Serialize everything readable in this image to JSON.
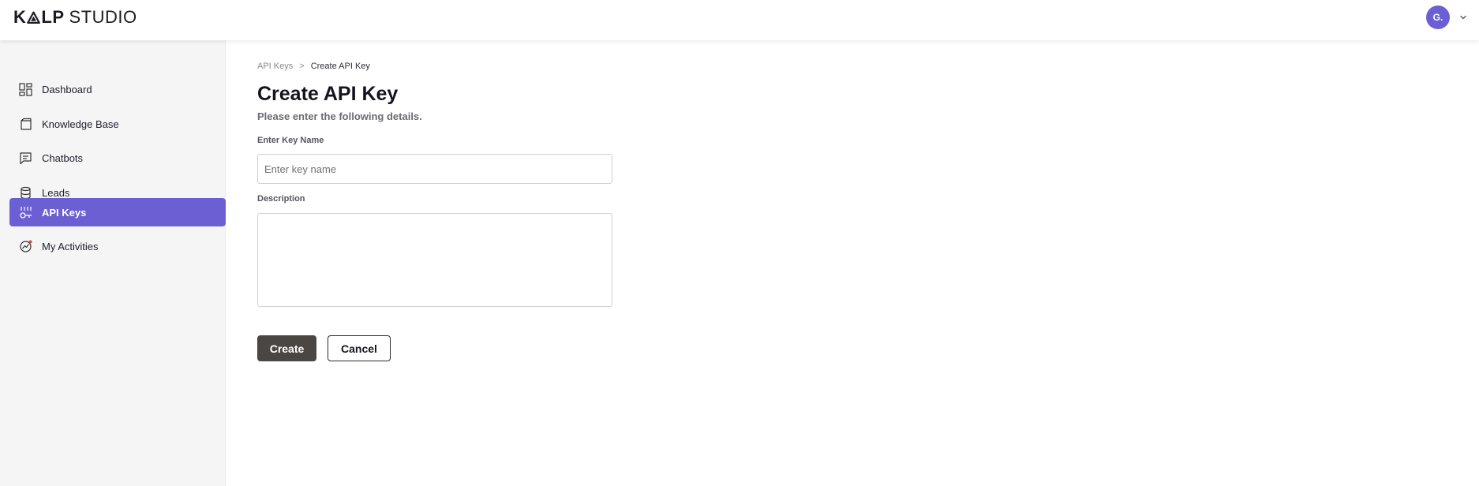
{
  "header": {
    "logo_bold": "K",
    "logo_bold2": "LP",
    "logo_light": "STUDIO",
    "avatar_initials": "G."
  },
  "sidebar": {
    "items": [
      {
        "label": "Dashboard",
        "icon": "dashboard-icon",
        "active": false
      },
      {
        "label": "Knowledge Base",
        "icon": "knowledge-base-icon",
        "active": false
      },
      {
        "label": "Chatbots",
        "icon": "chatbots-icon",
        "active": false
      },
      {
        "label": "Leads",
        "icon": "leads-icon",
        "active": false
      },
      {
        "label": "API Keys",
        "icon": "api-keys-icon",
        "active": true
      },
      {
        "label": "My Activities",
        "icon": "my-activities-icon",
        "active": false
      }
    ]
  },
  "breadcrumb": {
    "parent": "API Keys",
    "separator": ">",
    "current": "Create API Key"
  },
  "form": {
    "title": "Create API Key",
    "subtitle": "Please enter the following details.",
    "key_name_label": "Enter Key Name",
    "key_name_placeholder": "Enter key name",
    "key_name_value": "",
    "description_label": "Description",
    "description_value": "",
    "create_label": "Create",
    "cancel_label": "Cancel"
  },
  "colors": {
    "accent": "#6c5fd3",
    "primary_button": "#4a4644",
    "sidebar_bg": "#f5f5f5"
  }
}
